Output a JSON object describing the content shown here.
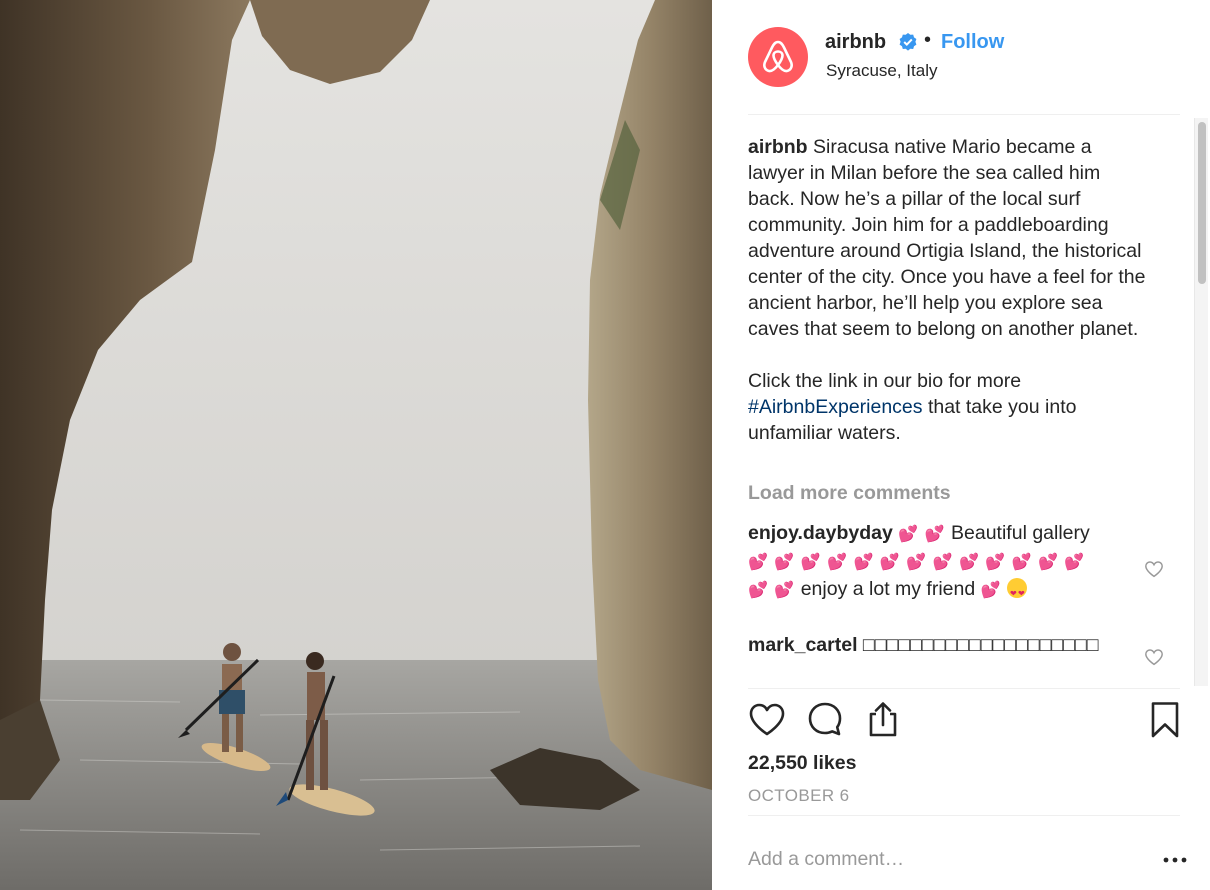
{
  "header": {
    "username": "airbnb",
    "separator": "•",
    "follow_label": "Follow",
    "location": "Syracuse, Italy"
  },
  "caption": {
    "username": "airbnb",
    "text_before_hashtag": " Siracusa native Mario became a lawyer in Milan before the sea called him back. Now he’s a pillar of the local surf community. Join him for a paddleboarding adventure around Ortigia Island, the historical center of the city. Once you have a feel for the ancient harbor, he’ll help you explore sea caves that seem to belong on another planet.\n\nClick the link in our bio for more ",
    "hashtag": "#AirbnbExperiences",
    "text_after_hashtag": " that take you into unfamiliar waters."
  },
  "load_more_label": "Load more comments",
  "comments": [
    {
      "username": "enjoy.daybyday",
      "emoji_lead": "💕 💕",
      "text_1": " Beautiful gallery ",
      "emoji_mid": "💕 💕 💕 💕 💕 💕 💕 💕 💕 💕 💕 💕 💕 💕 💕",
      "text_2": " enjoy a lot my friend ",
      "emoji_end": "💕"
    },
    {
      "username": "mark_cartel",
      "text": " □□□□□□□□□□□□□□□□□□□□"
    }
  ],
  "likes_label": "22,550 likes",
  "date_label": "OCTOBER 6",
  "add_comment_placeholder": "Add a comment…",
  "colors": {
    "brand": "#ff5a5f",
    "link": "#3897f0",
    "hashtag": "#003569",
    "muted": "#999999"
  },
  "icons": {
    "avatar": "airbnb-logo-icon",
    "verified": "verified-badge-icon",
    "like": "heart-outline-icon",
    "comment": "speech-bubble-icon",
    "share": "share-upload-icon",
    "save": "bookmark-icon",
    "more": "ellipsis-icon"
  }
}
